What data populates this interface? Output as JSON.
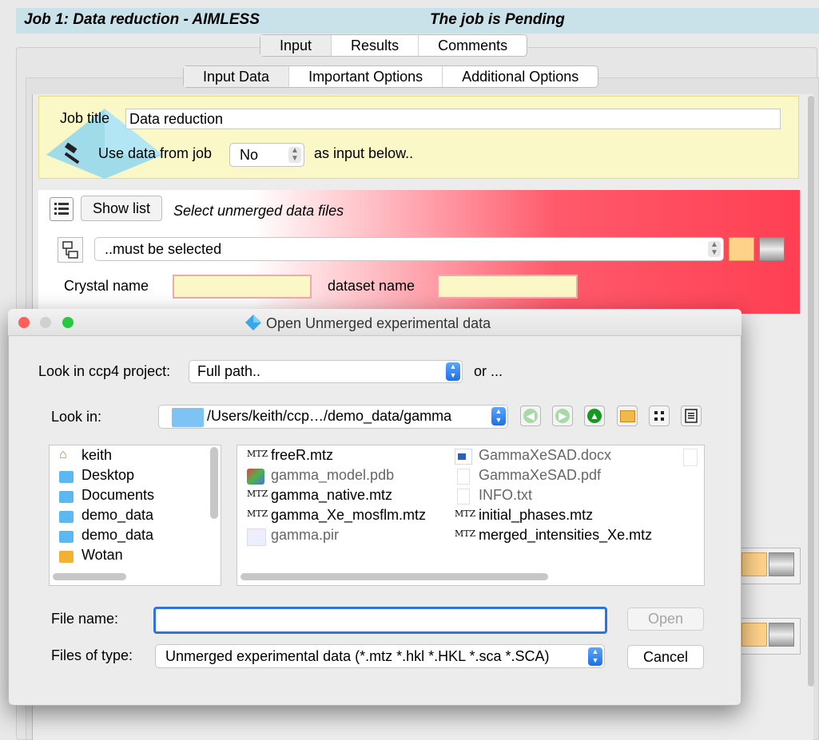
{
  "job_header": {
    "title": "Job 1:  Data reduction - AIMLESS",
    "status": "The job is Pending"
  },
  "main_tabs": [
    {
      "label": "Input",
      "selected": true
    },
    {
      "label": "Results",
      "selected": false
    },
    {
      "label": "Comments",
      "selected": false
    }
  ],
  "sub_tabs": [
    {
      "label": "Input Data",
      "selected": true
    },
    {
      "label": "Important Options",
      "selected": false
    },
    {
      "label": "Additional Options",
      "selected": false
    }
  ],
  "form": {
    "job_title_label": "Job title",
    "job_title_value": "Data reduction",
    "use_data_label": "Use data from job",
    "use_data_value": "No",
    "as_input_label": "as input below..",
    "show_list_label": "Show list",
    "unmerged_label": "Select unmerged data files",
    "must_select_value": "..must be selected",
    "crystal_label": "Crystal name",
    "dataset_label": "dataset name"
  },
  "dialog": {
    "title": "Open Unmerged experimental data",
    "look_project_label": "Look in ccp4 project:",
    "look_project_value": "Full path..",
    "or_label": "or ...",
    "look_in_label": "Look in:",
    "look_in_value": "/Users/keith/ccp…/demo_data/gamma",
    "sidebar": [
      {
        "label": "keith",
        "icon": "home-icon"
      },
      {
        "label": "Desktop",
        "icon": "folder-icon"
      },
      {
        "label": "Documents",
        "icon": "folder-icon"
      },
      {
        "label": "demo_data",
        "icon": "folder-icon"
      },
      {
        "label": "demo_data",
        "icon": "folder-icon"
      },
      {
        "label": "Wotan",
        "icon": "drive-icon"
      }
    ],
    "files_col1": [
      {
        "name": "freeR.mtz",
        "icon": "MTZ",
        "muted": false
      },
      {
        "name": "gamma_model.pdb",
        "icon": "pdb",
        "muted": true
      },
      {
        "name": "gamma_native.mtz",
        "icon": "MTZ",
        "muted": false
      },
      {
        "name": "gamma_Xe_mosflm.mtz",
        "icon": "MTZ",
        "muted": false
      },
      {
        "name": "gamma.pir",
        "icon": "pir",
        "muted": true
      }
    ],
    "files_col2": [
      {
        "name": "GammaXeSAD.docx",
        "icon": "docx",
        "muted": true
      },
      {
        "name": "GammaXeSAD.pdf",
        "icon": "blank",
        "muted": true
      },
      {
        "name": "INFO.txt",
        "icon": "blank",
        "muted": true
      },
      {
        "name": "initial_phases.mtz",
        "icon": "MTZ",
        "muted": false
      },
      {
        "name": "merged_intensities_Xe.mtz",
        "icon": "MTZ",
        "muted": false
      }
    ],
    "file_name_label": "File name:",
    "file_name_value": "",
    "open_label": "Open",
    "file_type_label": "Files of type:",
    "file_type_value": "Unmerged experimental data (*.mtz *.hkl *.HKL *.sca *.SCA)",
    "cancel_label": "Cancel"
  },
  "colors": {
    "header_bg": "#c9e2ea",
    "yellow_bg": "#fbf8c8",
    "red_accent": "#ff3f53",
    "focus_blue": "#2d74e0"
  }
}
